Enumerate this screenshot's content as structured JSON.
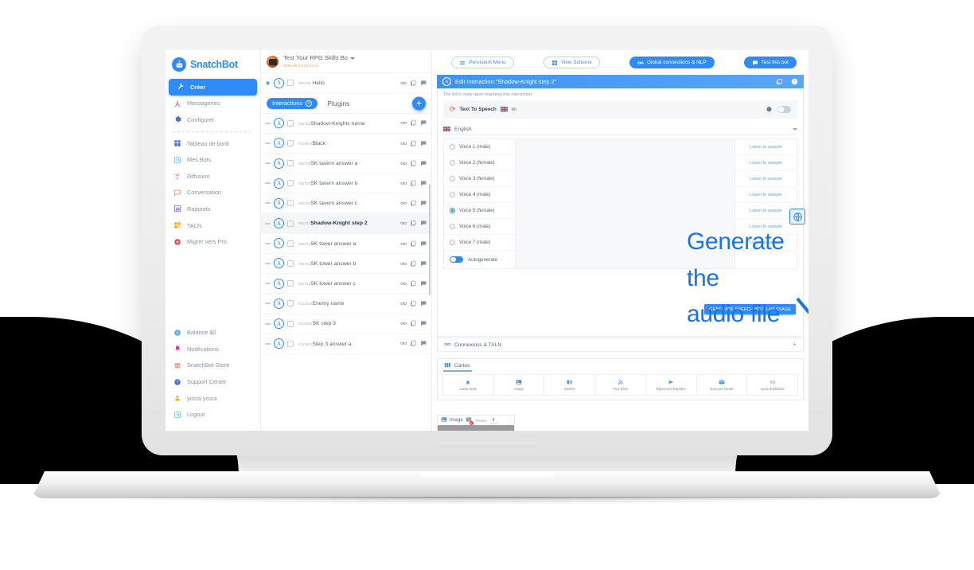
{
  "annotation": {
    "line1": "Generate the",
    "line2": "audio file",
    "color": "#1a73e8"
  },
  "brand": {
    "name": "SnatchBot",
    "color": "#2f8bf5"
  },
  "sidebar": {
    "items": [
      {
        "label": "Créer",
        "icon": "wrench-icon",
        "active": true
      },
      {
        "label": "Messageries",
        "icon": "share-nodes-icon",
        "active": false
      },
      {
        "label": "Configurer",
        "icon": "gear-icon",
        "active": false
      },
      {
        "label": "Tableau de bord",
        "icon": "dashboard-grid-icon",
        "active": false
      },
      {
        "label": "Mes Bots",
        "icon": "bot-card-icon",
        "active": false
      },
      {
        "label": "Diffusion",
        "icon": "broadcast-icon",
        "active": false
      },
      {
        "label": "Conversation",
        "icon": "chat-bubble-icon",
        "active": false
      },
      {
        "label": "Rapports",
        "icon": "bar-chart-icon",
        "active": false
      },
      {
        "label": "TALN",
        "icon": "puzzle-blocks-icon",
        "active": false
      },
      {
        "label": "Migrer vers Pro",
        "icon": "plus-circle-icon",
        "active": false
      }
    ],
    "bottom_items": [
      {
        "label": "Balance $0",
        "icon": "dollar-coin-icon"
      },
      {
        "label": "Notifications",
        "icon": "bell-icon"
      },
      {
        "label": "SnatchBot Store",
        "icon": "store-icon"
      },
      {
        "label": "Support Center",
        "icon": "question-circle-icon"
      },
      {
        "label": "yosra yosra",
        "icon": "user-icon"
      },
      {
        "label": "Logout",
        "icon": "logout-arrow-icon"
      }
    ]
  },
  "bot_header": {
    "name": "Test Your RPG Skills Bo",
    "timestamp": "2018-08-13 22:22:42"
  },
  "list_tabs": {
    "interactions_label": "Interactions",
    "interactions_badge": "0",
    "plugins_label": "Plugins",
    "add_label": "+"
  },
  "pinned_interaction": {
    "id": "#95796",
    "name": "Hello"
  },
  "interactions": [
    {
      "id": "#95795",
      "name": "Shadow-Knights name",
      "selected": false
    },
    {
      "id": "#116573",
      "name": "Black",
      "selected": false
    },
    {
      "id": "#95788",
      "name": "SK tavern answer a",
      "selected": false
    },
    {
      "id": "#95789",
      "name": "SK tavern answer b",
      "selected": false
    },
    {
      "id": "#95790",
      "name": "SK tavern answer c",
      "selected": false
    },
    {
      "id": "#95787",
      "name": "Shadow-Knight step 2",
      "selected": true
    },
    {
      "id": "#95791",
      "name": "SK tower answer a",
      "selected": false
    },
    {
      "id": "#95792",
      "name": "SK tower answer b",
      "selected": false
    },
    {
      "id": "#95793",
      "name": "SK tower answer c",
      "selected": false
    },
    {
      "id": "#112594",
      "name": "Enemy name",
      "selected": false
    },
    {
      "id": "#112555",
      "name": "SK step 3",
      "selected": false
    },
    {
      "id": "#112642",
      "name": "Step 3 answer a",
      "selected": false
    }
  ],
  "toolbar": [
    {
      "label": "Persistent Menu",
      "icon": "menu-icon",
      "style": "outline"
    },
    {
      "label": "View Scheme",
      "icon": "grid-icon",
      "style": "outline"
    },
    {
      "label": "Global connections & NLP",
      "icon": "link-icon",
      "style": "filled"
    },
    {
      "label": "Test this bot",
      "icon": "chat-icon",
      "style": "filled"
    }
  ],
  "edit_panel": {
    "title": "Edit Interaction:\"Shadow-Knight step 2\"",
    "reply_hint": "The bot's reply upon reaching this interaction.",
    "tts": {
      "label": "Text To Speech",
      "lang_code": "en",
      "toggle_on": false
    },
    "language_selected": "English",
    "voices": [
      {
        "label": "Voice 1 (male)",
        "selected": false,
        "sample": "Listen to sample"
      },
      {
        "label": "Voice 2 (female)",
        "selected": false,
        "sample": "Listen to sample"
      },
      {
        "label": "Voice 3 (female)",
        "selected": false,
        "sample": "Listen to sample"
      },
      {
        "label": "Voice 4 (male)",
        "selected": false,
        "sample": "Listen to sample"
      },
      {
        "label": "Voice 5 (female)",
        "selected": true,
        "sample": "Listen to sample"
      },
      {
        "label": "Voice 6 (male)",
        "selected": false,
        "sample": "Listen to sample"
      },
      {
        "label": "Voice 7 (male)",
        "selected": false,
        "sample": "Listen to sample"
      }
    ],
    "autogenerate": {
      "label": "Autogenerate",
      "on": true
    },
    "generate_button": "GENERATE SPEECH BOT'S MESSAGE"
  },
  "connections_section": {
    "label": "Connexions & TALN",
    "expand": "+"
  },
  "cards_section": {
    "label": "Cartes",
    "types": [
      {
        "label": "Carte texte",
        "icon": "text-card-icon"
      },
      {
        "label": "Image",
        "icon": "image-icon"
      },
      {
        "label": "Galerie",
        "icon": "gallery-icon"
      },
      {
        "label": "Flux RSS",
        "icon": "rss-icon"
      },
      {
        "label": "Réponses Rapides",
        "icon": "quick-reply-icon"
      },
      {
        "label": "Envoyer Email",
        "icon": "email-icon"
      },
      {
        "label": "Ajout d'attributs",
        "icon": "code-attribute-icon"
      }
    ]
  },
  "image_card": {
    "title": "Image",
    "badge_count": "0",
    "delay_label": "Retard",
    "delay_value": "4"
  }
}
